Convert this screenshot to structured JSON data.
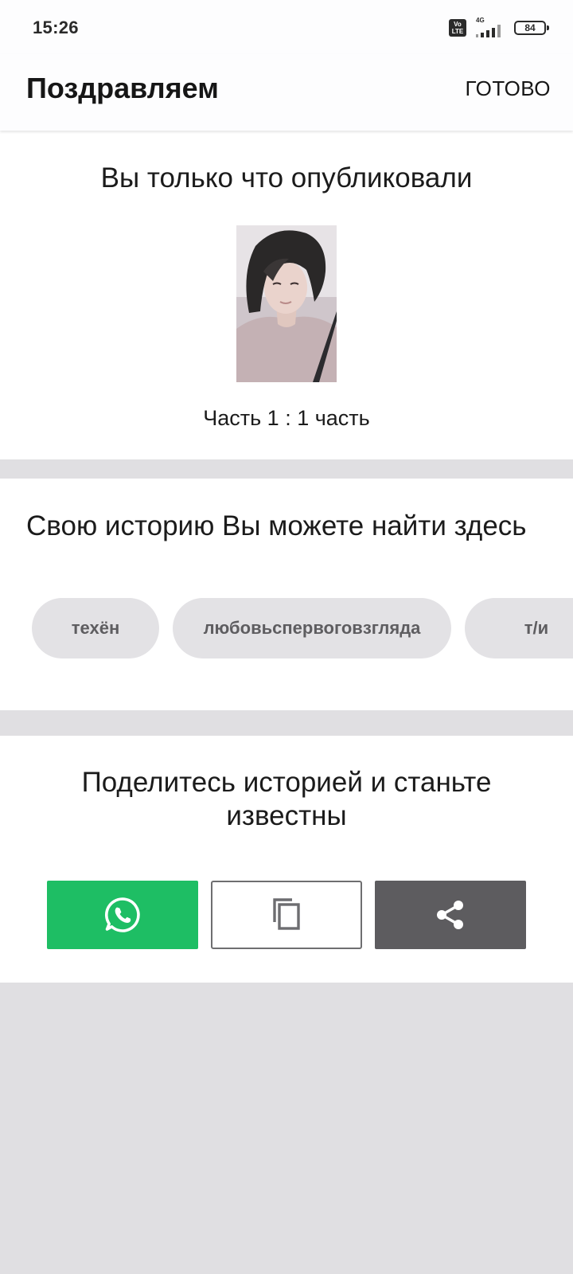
{
  "status_bar": {
    "time": "15:26",
    "volte_label": "Vo LTE",
    "network": "4G",
    "battery": "84"
  },
  "app_bar": {
    "title": "Поздравляем",
    "done_label": "ГОТОВО"
  },
  "published": {
    "heading": "Вы только что опубликовали",
    "part_label": "Часть 1 : 1 часть"
  },
  "find": {
    "heading": "Свою историю Вы можете найти здесь",
    "tags": [
      "техён",
      "любовьспервоговзгляда",
      "т/и"
    ]
  },
  "share": {
    "heading": "Поделитесь историей и станьте известны",
    "buttons": {
      "whatsapp_icon": "whatsapp-icon",
      "copy_icon": "copy-icon",
      "share_icon": "share-icon"
    }
  },
  "colors": {
    "whatsapp_green": "#1ebe64",
    "share_gray": "#5d5c5f",
    "tag_bg": "#e3e2e5",
    "page_bg": "#e0dfe2"
  }
}
